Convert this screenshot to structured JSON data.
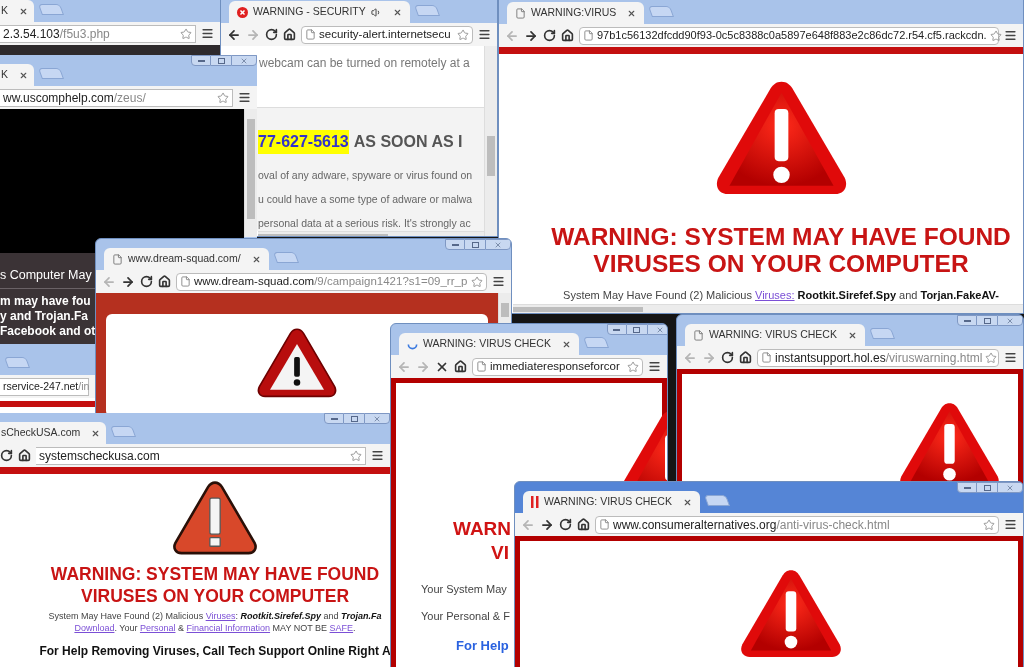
{
  "windows": [
    {
      "active": false,
      "tab": {
        "title": "K"
      },
      "url": {
        "host": "2.3.54.103",
        "path": "/f5u3.php"
      },
      "content": {
        "kind": "dark"
      }
    },
    {
      "active": false,
      "tab": {
        "title": "WARNING - SECURITY",
        "audio": true
      },
      "nav": {
        "can_go_back": true,
        "can_go_forward": false,
        "loading": false
      },
      "url": {
        "host": "security-alert.internetsecu"
      },
      "content": {
        "kind": "alert",
        "top_line": "webcam can be turned on remotely at a",
        "phone": "77-627-5613",
        "phone_rest": "AS SOON AS I",
        "lines": [
          "oval of any adware, spyware or virus found on",
          "u could have a some type of adware or malwa",
          "personal data at a serious risk. It's strongly ac"
        ]
      }
    },
    {
      "active": false,
      "tab": {
        "title": "K"
      },
      "url": {
        "host": "ww.uscomphelp.com",
        "path": "/zeus/"
      },
      "content": {
        "kind": "video",
        "heading": "s Computer May",
        "lines": [
          "m may have fou",
          "y and Trojan.Fa",
          "Facebook and ot"
        ]
      }
    },
    {
      "active": false,
      "url": {
        "host": "rservice-247.net",
        "path": "/in"
      },
      "content": {
        "kind": "strip"
      }
    },
    {
      "active": false,
      "tab": {
        "title": "WARNING:VIRUS"
      },
      "nav": {
        "can_go_back": false,
        "can_go_forward": true,
        "loading": false
      },
      "url": {
        "host": "97b1c56132dfcdd90f93-0c5c8388c0a5897e648f883e2c86dc72.r54.cf5.rackcdn."
      },
      "content": {
        "kind": "warning",
        "headline": [
          "WARNING: SYSTEM MAY HAVE FOUND",
          "VIRUSES ON YOUR COMPUTER"
        ],
        "paragraph": [
          [
            {
              "kind": "text",
              "text": "System May Have Found (2) Malicious "
            },
            {
              "kind": "link",
              "text": "Viruses:"
            },
            {
              "kind": "text",
              "text": " **Rootkit.Sirefef.Spy** and **Torjan.FakeAV-**"
            }
          ]
        ]
      }
    },
    {
      "active": false,
      "tab": {
        "title": "www.dream-squad.com/"
      },
      "nav": {
        "can_go_back": false,
        "can_go_forward": true,
        "loading": false
      },
      "url": {
        "host": "www.dream-squad.com",
        "path": "/9/campaign1421?s1=09_rr_p"
      },
      "content": {
        "kind": "panel"
      }
    },
    {
      "active": false,
      "tab": {
        "title": "sCheckUSA.com"
      },
      "nav": {
        "loading": false
      },
      "url": {
        "host": "systemscheckusa.com"
      },
      "content": {
        "kind": "warning",
        "headline": [
          "WARNING: SYSTEM MAY HAVE FOUND",
          "VIRUSES ON YOUR COMPUTER"
        ],
        "paragraph": [
          [
            {
              "kind": "text",
              "text": "System May Have Found (2) Malicious "
            },
            {
              "kind": "link",
              "text": "Viruses"
            },
            {
              "kind": "text",
              "text": ": **Rootkit.Sirefef.Spy** and **Trojan.Fa**"
            }
          ],
          [
            {
              "kind": "link",
              "text": "Download"
            },
            {
              "kind": "text",
              "text": ". Your "
            },
            {
              "kind": "link",
              "text": "Personal"
            },
            {
              "kind": "text",
              "text": " & "
            },
            {
              "kind": "link",
              "text": "Financial Information"
            },
            {
              "kind": "text",
              "text": " MAY NOT BE "
            },
            {
              "kind": "link",
              "text": "SAFE"
            },
            {
              "kind": "text",
              "text": "."
            }
          ]
        ],
        "help": "For Help Removing Viruses, Call Tech Support Online Right A"
      }
    },
    {
      "active": false,
      "tab": {
        "title": "WARNING: VIRUS CHECK"
      },
      "nav": {
        "can_go_back": false,
        "can_go_forward": false,
        "loading": true
      },
      "url": {
        "host": "immediateresponseforcor"
      },
      "content": {
        "kind": "framed",
        "headline": [
          "WARN",
          "VI"
        ],
        "lines": [
          "Your System May",
          "Your Personal & F"
        ],
        "help": "For Help"
      }
    },
    {
      "active": false,
      "tab": {
        "title": "WARNING: VIRUS CHECK"
      },
      "nav": {
        "can_go_back": false,
        "can_go_forward": false,
        "loading": false
      },
      "url": {
        "host": "instantsupport.hol.es",
        "path": "/viruswarning.html"
      },
      "content": {
        "kind": "framed"
      }
    },
    {
      "active": true,
      "tab": {
        "title": "WARNING: VIRUS CHECK"
      },
      "nav": {
        "can_go_back": false,
        "can_go_forward": true,
        "loading": false
      },
      "url": {
        "host": "www.consumeralternatives.org",
        "path": "/anti-virus-check.html"
      },
      "content": {
        "kind": "framed"
      }
    }
  ]
}
